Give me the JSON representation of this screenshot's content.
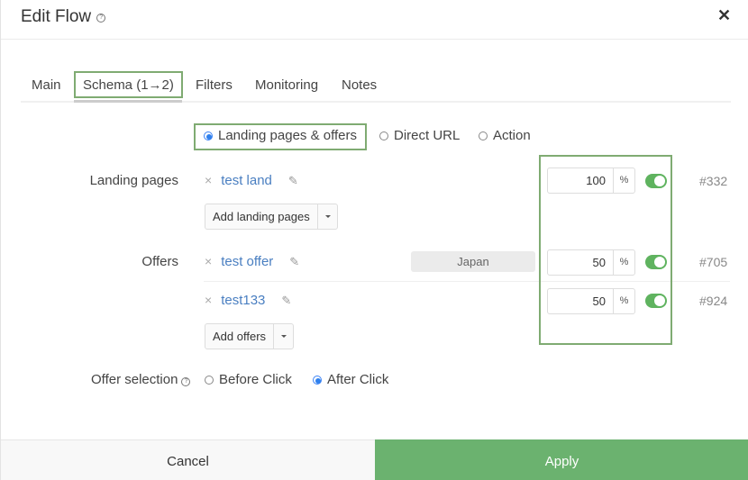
{
  "header": {
    "title": "Edit Flow",
    "help_icon": "?",
    "close_icon": "✕"
  },
  "tabs": [
    {
      "label": "Main"
    },
    {
      "label": "Schema (1→2)",
      "active": true
    },
    {
      "label": "Filters"
    },
    {
      "label": "Monitoring"
    },
    {
      "label": "Notes"
    }
  ],
  "schema_options": [
    {
      "label": "Landing pages & offers",
      "checked": true
    },
    {
      "label": "Direct URL",
      "checked": false
    },
    {
      "label": "Action",
      "checked": false
    }
  ],
  "landing_pages": {
    "label": "Landing pages",
    "items": [
      {
        "name": "test land",
        "weight": "100",
        "unit": "%",
        "enabled": true,
        "id": "#332"
      }
    ],
    "add_button": "Add landing pages"
  },
  "offers": {
    "label": "Offers",
    "items": [
      {
        "name": "test offer",
        "tag": "Japan",
        "weight": "50",
        "unit": "%",
        "enabled": true,
        "id": "#705"
      },
      {
        "name": "test133",
        "weight": "50",
        "unit": "%",
        "enabled": true,
        "id": "#924"
      }
    ],
    "add_button": "Add offers"
  },
  "offer_selection": {
    "label": "Offer selection",
    "help_icon": "?",
    "options": [
      {
        "label": "Before Click",
        "checked": false
      },
      {
        "label": "After Click",
        "checked": true
      }
    ]
  },
  "footer": {
    "cancel": "Cancel",
    "apply": "Apply"
  },
  "icons": {
    "remove": "×",
    "edit": "✎"
  },
  "colors": {
    "accent_green": "#6bb26f",
    "highlight_border": "#7fab72",
    "link": "#4a7fc1",
    "radio_checked": "#2f80ed"
  }
}
